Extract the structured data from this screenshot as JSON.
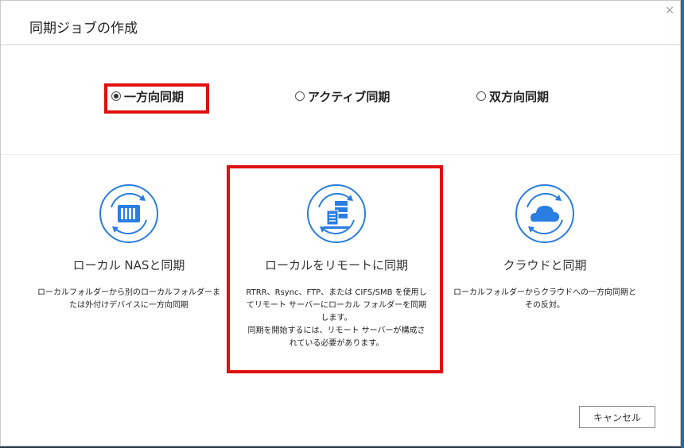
{
  "dialog": {
    "title": "同期ジョブの作成",
    "close_glyph": "×"
  },
  "sync_modes": [
    {
      "label": "一方向同期",
      "selected": true
    },
    {
      "label": "アクティブ同期",
      "selected": false
    },
    {
      "label": "双方向同期",
      "selected": false
    }
  ],
  "cards": [
    {
      "title": "ローカル  NASと同期",
      "icon": "nas-icon",
      "description": "ローカルフォルダーから別のローカルフォルダーま\nたは外付けデバイスに一方向同期"
    },
    {
      "title": "ローカルをリモートに同期",
      "icon": "server-icon",
      "description": "RTRR、Rsync、FTP、または CIFS/SMB を使用し\nてリモート サーバーにローカル フォルダーを同期\nします。\n同期を開始するには、リモート サーバーが構成さ\nれている必要があります。"
    },
    {
      "title": "クラウドと同期",
      "icon": "cloud-icon",
      "description": "ローカルフォルダーからクラウドへの一方向同期と\nその反対。"
    }
  ],
  "footer": {
    "cancel_label": "キャンセル"
  },
  "colors": {
    "accent_blue": "#2a7de1",
    "highlight_red": "#e01010"
  }
}
